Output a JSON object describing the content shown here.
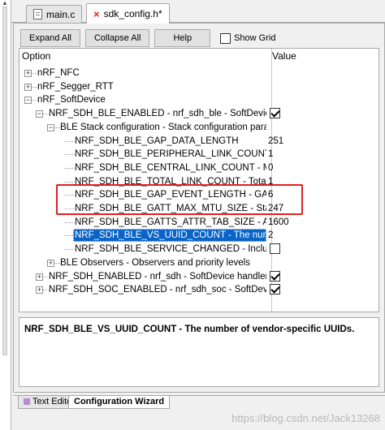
{
  "file_tabs": [
    {
      "label": "main.c",
      "active": false
    },
    {
      "label": "sdk_config.h*",
      "active": true
    }
  ],
  "toolbar": {
    "expand_all": "Expand All",
    "collapse_all": "Collapse All",
    "help": "Help",
    "show_grid_label": "Show Grid",
    "show_grid_checked": false
  },
  "columns": {
    "option": "Option",
    "value": "Value"
  },
  "tree": [
    {
      "label": "nRF_NFC",
      "value": "",
      "level": 0,
      "expander": "+"
    },
    {
      "label": "nRF_Segger_RTT",
      "value": "",
      "level": 0,
      "expander": "+"
    },
    {
      "label": "nRF_SoftDevice",
      "value": "",
      "level": 0,
      "expander": "-"
    },
    {
      "label": "NRF_SDH_BLE_ENABLED - nrf_sdh_ble - SoftDevice BLE eve...",
      "value": "",
      "checkbox": true,
      "level": 1,
      "expander": "-"
    },
    {
      "label": "BLE Stack configuration - Stack configuration parameters",
      "value": "",
      "level": 2,
      "expander": "-"
    },
    {
      "label": "NRF_SDH_BLE_GAP_DATA_LENGTH",
      "value": "251",
      "level": 3
    },
    {
      "label": "NRF_SDH_BLE_PERIPHERAL_LINK_COUNT - Maxim...",
      "value": "1",
      "level": 3
    },
    {
      "label": "NRF_SDH_BLE_CENTRAL_LINK_COUNT - Maximu...",
      "value": "0",
      "level": 3
    },
    {
      "label": "NRF_SDH_BLE_TOTAL_LINK_COUNT - Total link cou...",
      "value": "1",
      "level": 3
    },
    {
      "label": "NRF_SDH_BLE_GAP_EVENT_LENGTH - GAP event le...",
      "value": "6",
      "level": 3
    },
    {
      "label": "NRF_SDH_BLE_GATT_MAX_MTU_SIZE - Static maxi...",
      "value": "247",
      "level": 3
    },
    {
      "label": "NRF_SDH_BLE_GATTS_ATTR_TAB_SIZE - Attribute Ta...",
      "value": "1600",
      "level": 3
    },
    {
      "label": "NRF_SDH_BLE_VS_UUID_COUNT - The number of v...",
      "value": "2",
      "level": 3,
      "selected": true
    },
    {
      "label": "NRF_SDH_BLE_SERVICE_CHANGED - Include the Se...",
      "value": "",
      "checkbox": false,
      "level": 3
    },
    {
      "label": "BLE Observers - Observers and priority levels",
      "value": "",
      "level": 2,
      "expander": "+"
    },
    {
      "label": "NRF_SDH_ENABLED - nrf_sdh - SoftDevice handler",
      "value": "",
      "checkbox": true,
      "level": 1,
      "expander": "+"
    },
    {
      "label": "NRF_SDH_SOC_ENABLED - nrf_sdh_soc - SoftDevice SoC ev...",
      "value": "",
      "checkbox": true,
      "level": 1,
      "expander": "+"
    }
  ],
  "description": "NRF_SDH_BLE_VS_UUID_COUNT - The number of vendor-specific UUIDs.",
  "bottom_tabs": [
    {
      "label": "Text Editor",
      "active": false
    },
    {
      "label": "Configuration Wizard",
      "active": true
    }
  ],
  "watermark": "https://blog.csdn.net/Jack13268",
  "colors": {
    "selection": "#0a64c8",
    "highlight_box": "#e02020"
  }
}
